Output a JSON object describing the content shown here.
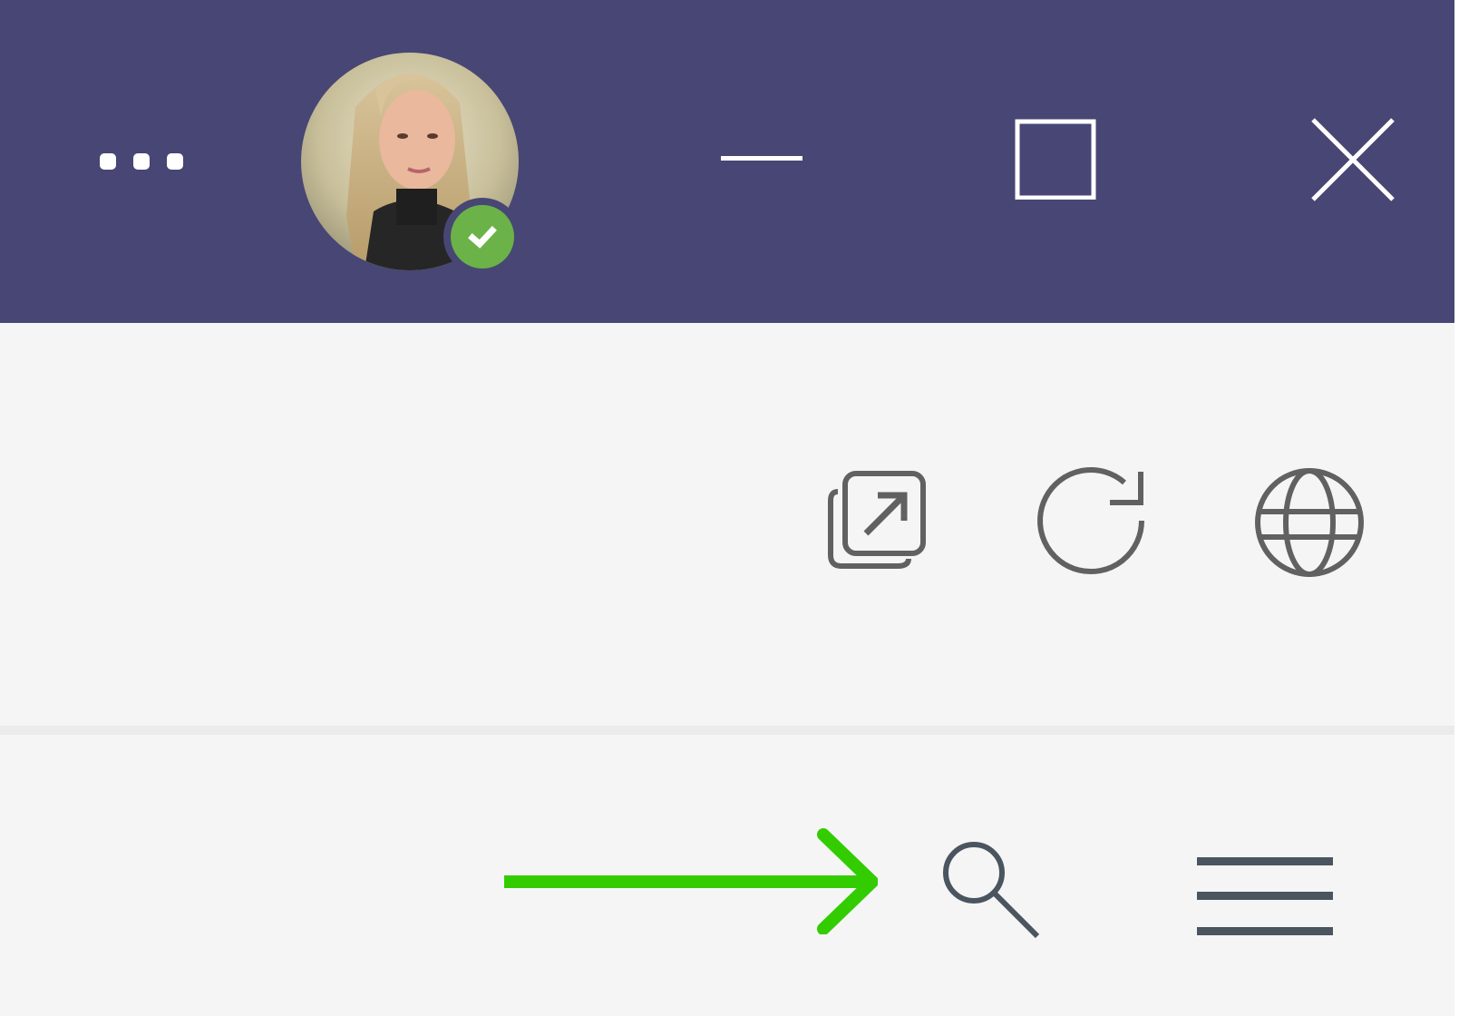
{
  "titlebar": {
    "background": "#474674",
    "more_icon": "more-horizontal-icon",
    "avatar": {
      "presence_status_color": "#6bb248",
      "presence_icon": "checkmark-icon"
    },
    "window_controls": {
      "minimize_icon": "minimize-icon",
      "maximize_icon": "maximize-icon",
      "close_icon": "close-icon"
    }
  },
  "toolbar": {
    "icons": [
      "popout-icon",
      "refresh-icon",
      "globe-icon"
    ],
    "icon_color": "#616161"
  },
  "bottom_bar": {
    "annotation_arrow_color": "#33cc00",
    "search_icon": "search-icon",
    "menu_icon": "hamburger-menu-icon",
    "icon_color": "#4a5560"
  }
}
